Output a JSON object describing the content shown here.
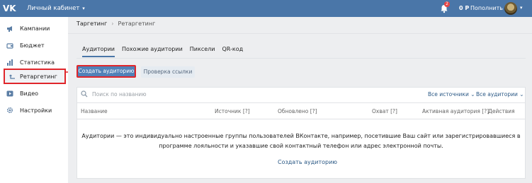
{
  "topbar": {
    "logo": "VK",
    "cabinet_title": "Личный кабинет",
    "notifications_count": "2",
    "balance": "0 Р",
    "topup_label": "Пополнить",
    "accent_color": "#4a76a8"
  },
  "sidebar": {
    "items": [
      {
        "label": "Кампании",
        "icon": "megaphone-icon"
      },
      {
        "label": "Бюджет",
        "icon": "wallet-icon"
      },
      {
        "label": "Статистика",
        "icon": "bar-chart-icon"
      },
      {
        "label": "Ретаргетинг",
        "icon": "retarget-icon",
        "active": true
      },
      {
        "label": "Видео",
        "icon": "play-icon"
      },
      {
        "label": "Настройки",
        "icon": "gear-icon"
      }
    ]
  },
  "breadcrumb": {
    "root": "Таргетинг",
    "current": "Ретаргетинг"
  },
  "tabs": [
    {
      "label": "Аудитории",
      "active": true
    },
    {
      "label": "Похожие аудитории"
    },
    {
      "label": "Пиксели"
    },
    {
      "label": "QR-код"
    }
  ],
  "actions": {
    "create_label": "Создать аудиторию",
    "check_label": "Проверка ссылки"
  },
  "search": {
    "placeholder": "Поиск по названию"
  },
  "filters": {
    "sources": "Все источники",
    "audiences": "Все аудитории"
  },
  "table": {
    "columns": [
      "Название",
      "Источник [?]",
      "Обновлено [?]",
      "Охват [?]",
      "Активная аудитория [?]",
      "Действия"
    ]
  },
  "empty_state": {
    "text": "Аудитории — это индивидуально настроенные группы пользователей ВКонтакте, например, посетившие Ваш сайт или зарегистрировавшиеся в программе лояльности и указавшие свой контактный телефон или адрес электронной почты.",
    "link": "Создать аудиторию"
  },
  "highlight_color": "#e0262b"
}
